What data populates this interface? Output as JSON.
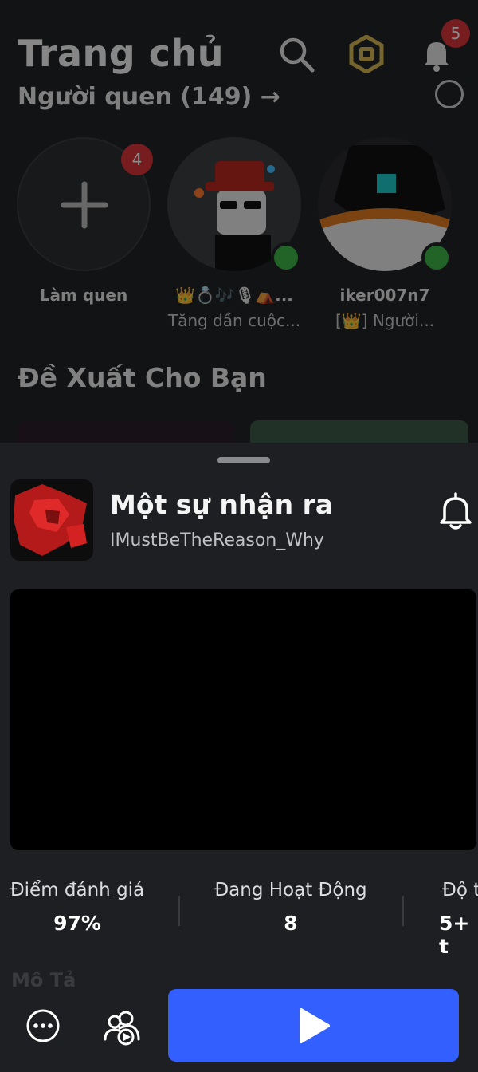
{
  "header": {
    "title": "Trang chủ",
    "notifications_count": "5"
  },
  "friends_section": {
    "title_peek": "Người quen (149) →",
    "add_friend": {
      "label": "Làm quen",
      "badge": "4"
    },
    "friends": [
      {
        "name": "👑💍🎶🎙⛺...",
        "status": "Tăng dần cuộc...",
        "online": true
      },
      {
        "name": "iker007n7",
        "status": "[👑] Người...",
        "online": true
      }
    ]
  },
  "recommended": {
    "title": "Đề Xuất Cho Bạn"
  },
  "game": {
    "title": "Một sự nhận ra",
    "creator": "IMustBeTheReason_Why",
    "stats": [
      {
        "label": "Điểm đánh giá",
        "value": "97%"
      },
      {
        "label": "Đang Hoạt Động",
        "value": "8"
      },
      {
        "label": "Độ t",
        "value": "5+ t"
      }
    ],
    "description_peek": "Mô Tả"
  },
  "colors": {
    "play_button": "#335fff",
    "badge_red": "#d9343a",
    "online_green": "#3fb54a"
  }
}
